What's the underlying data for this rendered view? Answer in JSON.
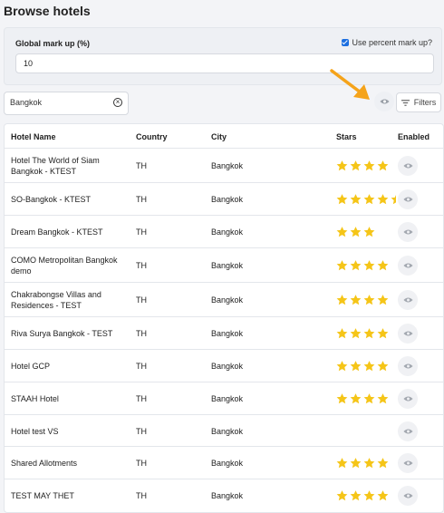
{
  "page": {
    "title": "Browse hotels"
  },
  "markup": {
    "label": "Global mark up (%)",
    "value": "10",
    "use_percent_label": "Use percent mark up?",
    "use_percent_checked": true
  },
  "search": {
    "value": "Bangkok"
  },
  "filters": {
    "label": "Filters"
  },
  "colors": {
    "star": "#f5c518",
    "arrow": "#f5a31a",
    "accent": "#1d6fe0"
  },
  "table": {
    "headers": {
      "name": "Hotel Name",
      "country": "Country",
      "city": "City",
      "stars": "Stars",
      "enabled": "Enabled"
    },
    "rows": [
      {
        "name": "Hotel The World of Siam Bangkok - KTEST",
        "country": "TH",
        "city": "Bangkok",
        "stars": 4
      },
      {
        "name": "SO-Bangkok - KTEST",
        "country": "TH",
        "city": "Bangkok",
        "stars": 4.5
      },
      {
        "name": "Dream Bangkok - KTEST",
        "country": "TH",
        "city": "Bangkok",
        "stars": 3
      },
      {
        "name": "COMO Metropolitan Bangkok demo",
        "country": "TH",
        "city": "Bangkok",
        "stars": 4
      },
      {
        "name": "Chakrabongse Villas and Residences - TEST",
        "country": "TH",
        "city": "Bangkok",
        "stars": 4
      },
      {
        "name": "Riva Surya Bangkok - TEST",
        "country": "TH",
        "city": "Bangkok",
        "stars": 4
      },
      {
        "name": "Hotel GCP",
        "country": "TH",
        "city": "Bangkok",
        "stars": 4
      },
      {
        "name": "STAAH Hotel",
        "country": "TH",
        "city": "Bangkok",
        "stars": 4
      },
      {
        "name": "Hotel test VS",
        "country": "TH",
        "city": "Bangkok",
        "stars": 0
      },
      {
        "name": "Shared Allotments",
        "country": "TH",
        "city": "Bangkok",
        "stars": 4
      },
      {
        "name": "TEST MAY THET",
        "country": "TH",
        "city": "Bangkok",
        "stars": 4
      }
    ]
  }
}
